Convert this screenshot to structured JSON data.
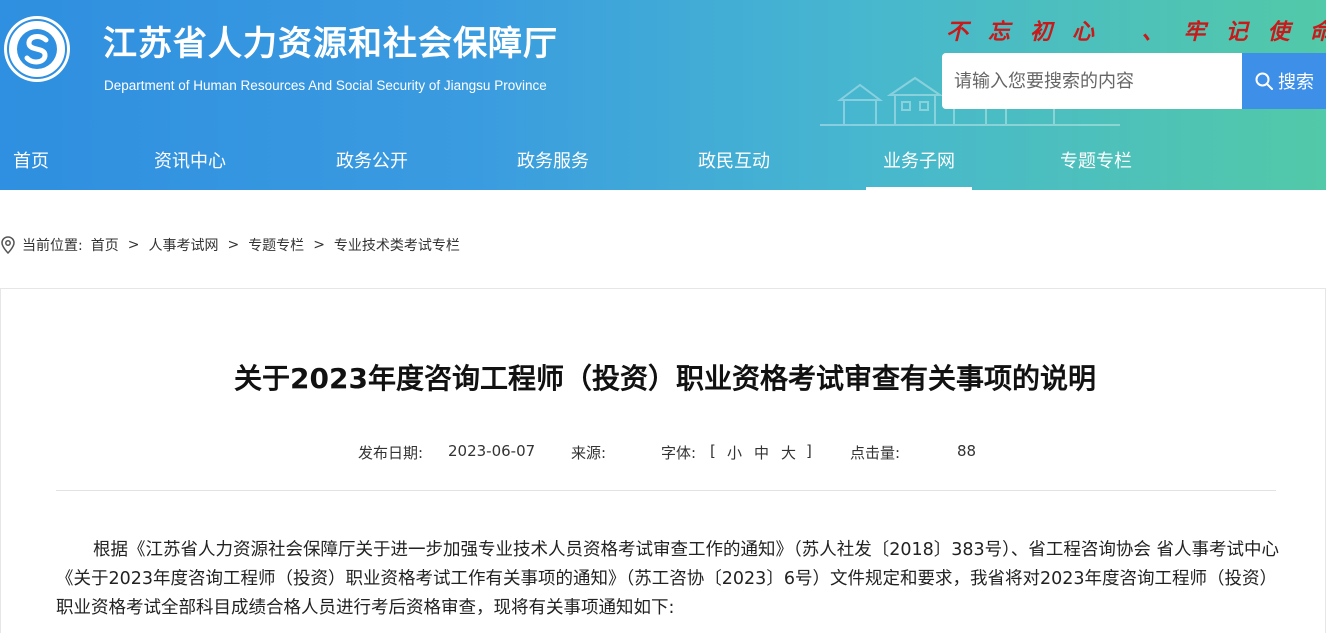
{
  "header": {
    "site_title": "江苏省人力资源和社会保障厅",
    "site_subtitle": "Department of Human Resources And Social Security of Jiangsu Province",
    "slogan": "不忘初心 、牢记使命",
    "logo_icon": "seal-logo-icon",
    "search": {
      "placeholder": "请输入您要搜索的内容",
      "button_label": "搜索"
    },
    "colors": {
      "gradient_start": "#2f8fe0",
      "gradient_end": "#52c9a8",
      "slogan": "#c81a1a",
      "search_button": "#3d8fe8"
    }
  },
  "nav": {
    "items": [
      {
        "label": "首页"
      },
      {
        "label": "资讯中心"
      },
      {
        "label": "政务公开"
      },
      {
        "label": "政务服务"
      },
      {
        "label": "政民互动"
      },
      {
        "label": "业务子网",
        "active": true
      },
      {
        "label": "专题专栏"
      }
    ]
  },
  "breadcrumb": {
    "prefix": "当前位置:",
    "items": [
      "首页",
      "人事考试网",
      "专题专栏",
      "专业技术类考试专栏"
    ],
    "separator": ">"
  },
  "article": {
    "title": "关于2023年度咨询工程师（投资）职业资格考试审查有关事项的说明",
    "meta": {
      "date_label": "发布日期:",
      "date": "2023-06-07",
      "source_label": "来源:",
      "font_label": "字体:",
      "font_open": "[",
      "font_small": "小",
      "font_medium": "中",
      "font_large": "大",
      "font_close": "]",
      "hits_label": "点击量:",
      "hits": "88"
    },
    "paragraph": "根据《江苏省人力资源社会保障厅关于进一步加强专业技术人员资格考试审查工作的通知》（苏人社发〔2018〕383号）、省工程咨询协会 省人事考试中心《关于2023年度咨询工程师（投资）职业资格考试工作有关事项的通知》（苏工咨协〔2023〕6号）文件规定和要求，我省将对2023年度咨询工程师（投资）职业资格考试全部科目成绩合格人员进行考后资格审查，现将有关事项通知如下:"
  }
}
